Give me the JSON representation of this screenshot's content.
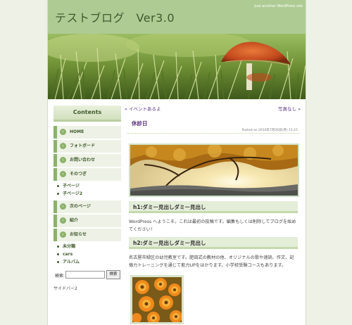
{
  "header": {
    "title": "テストブログ　Ver3.0",
    "tagline": "Just another WordPress site"
  },
  "sidebar": {
    "heading": "Contents",
    "items": [
      {
        "label": "HOME"
      },
      {
        "label": "フォトボード"
      },
      {
        "label": "お問い合わせ"
      },
      {
        "label": "そのつぎ"
      }
    ],
    "subitems_1": [
      {
        "label": "子ページ"
      },
      {
        "label": "子ページ2"
      }
    ],
    "items_2": [
      {
        "label": "次のページ"
      },
      {
        "label": "紹介"
      },
      {
        "label": "お知らせ"
      }
    ],
    "subitems_2": [
      {
        "label": "未分類"
      },
      {
        "label": "cars"
      },
      {
        "label": "アルバム"
      }
    ],
    "search": {
      "label": "検索:",
      "button": "検索",
      "value": ""
    },
    "sidebar2": "サイドバー2"
  },
  "main": {
    "prev_link": "« イベントあるよ",
    "next_link": "写真なし »",
    "post_title": "休診日",
    "post_meta": "Posted on 2010年7月26日(月) 11:15",
    "h1": "h1:ダミー見出しダミー見出し",
    "text1": "WordPress へようこそ。これは最初の投稿です。編集もしくは削除してブログを始めてください！",
    "h2": "h2:ダミー見出しダミー見出し",
    "text2": "名古屋市緑区の幼児教室です。肥田式の教材の他、オリジナルの歌や速読、作文、記憶力トレーニングを通じて能力UPをはかります。小学校受験コースもあります。"
  },
  "colors": {
    "header_bg": "#aecb94",
    "accent": "#8bb26a",
    "link": "#5a3080",
    "page_bg": "#eef1e6"
  }
}
